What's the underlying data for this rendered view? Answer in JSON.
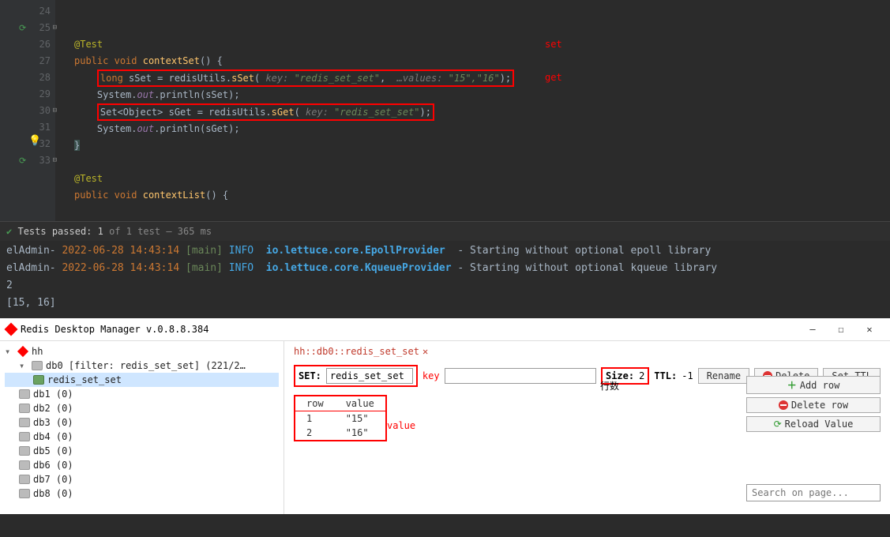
{
  "editor": {
    "line_numbers": [
      "",
      "24",
      "25",
      "26",
      "27",
      "28",
      "29",
      "30",
      "31",
      "32",
      "33",
      ""
    ],
    "ann1": "@Test",
    "sig1_kw1": "public",
    "sig1_kw2": "void",
    "sig1_name": "contextSet",
    "sig1_tail": "() {",
    "l26_long": "long",
    "l26_var": " sSet = redisUtils.",
    "l26_m": "sSet",
    "l26_p": "( ",
    "l26_k": "key:",
    "l26_ks": " \"redis_set_set\"",
    "l26_c": ",  ",
    "l26_v": "…values:",
    "l26_vs": " \"15\",\"16\"",
    "l26_e": ");",
    "l27_a": "System.",
    "l27_b": "out",
    "l27_c": ".println(sSet);",
    "l28_a": "Set<Object> sGet = redisUtils.",
    "l28_m": "sGet",
    "l28_p": "( ",
    "l28_k": "key:",
    "l28_ks": " \"redis_set_set\"",
    "l28_e": ");",
    "l29_a": "System.",
    "l29_b": "out",
    "l29_c": ".println(sGet);",
    "l30": "}",
    "ann2": "@Test",
    "sig2_kw1": "public",
    "sig2_kw2": "void",
    "sig2_name": "contextList",
    "sig2_tail": "() {",
    "label_set": "set",
    "label_get": "get"
  },
  "status": {
    "passed": "Tests passed: 1",
    "of": " of 1 test – 365 ms"
  },
  "console": {
    "l1_app": "elAdmin-",
    "l1_date": " 2022-06-28 14:43:14 ",
    "l1_th": "[main] ",
    "l1_lv": "INFO  ",
    "l1_lg": "io.lettuce.core.EpollProvider ",
    "l1_msg": " - Starting without optional epoll library",
    "l2_app": "elAdmin-",
    "l2_date": " 2022-06-28 14:43:14 ",
    "l2_th": "[main] ",
    "l2_lv": "INFO  ",
    "l2_lg": "io.lettuce.core.KqueueProvider",
    "l2_msg": " - Starting without optional kqueue library",
    "l3": "2",
    "l4": "[15, 16]"
  },
  "rdm": {
    "title": "Redis Desktop Manager v.0.8.8.384",
    "tree": {
      "root": "hh",
      "db0": "db0 [filter: redis_set_set] (221/2…",
      "key": "redis_set_set",
      "dbs": [
        "db1 (0)",
        "db2 (0)",
        "db3 (0)",
        "db4 (0)",
        "db5 (0)",
        "db6 (0)",
        "db7 (0)",
        "db8 (0)"
      ]
    },
    "tab": "hh::db0::redis_set_set",
    "type_label": "SET:",
    "key_value": "redis_set_set",
    "key_ann": "key",
    "size_label": "Size:",
    "size_value": "2",
    "rows_ann": "行数",
    "ttl_label": "TTL:",
    "ttl_value": "-1",
    "btn_rename": "Rename",
    "btn_delete": "Delete",
    "btn_setttl": "Set TTL",
    "btn_addrow": "Add row",
    "btn_delrow": "Delete row",
    "btn_reload": "Reload Value",
    "value_ann": "value",
    "th_row": "row",
    "th_val": "value",
    "rows": [
      {
        "r": "1",
        "v": "\"15\""
      },
      {
        "r": "2",
        "v": "\"16\""
      }
    ],
    "search_placeholder": "Search on page..."
  }
}
